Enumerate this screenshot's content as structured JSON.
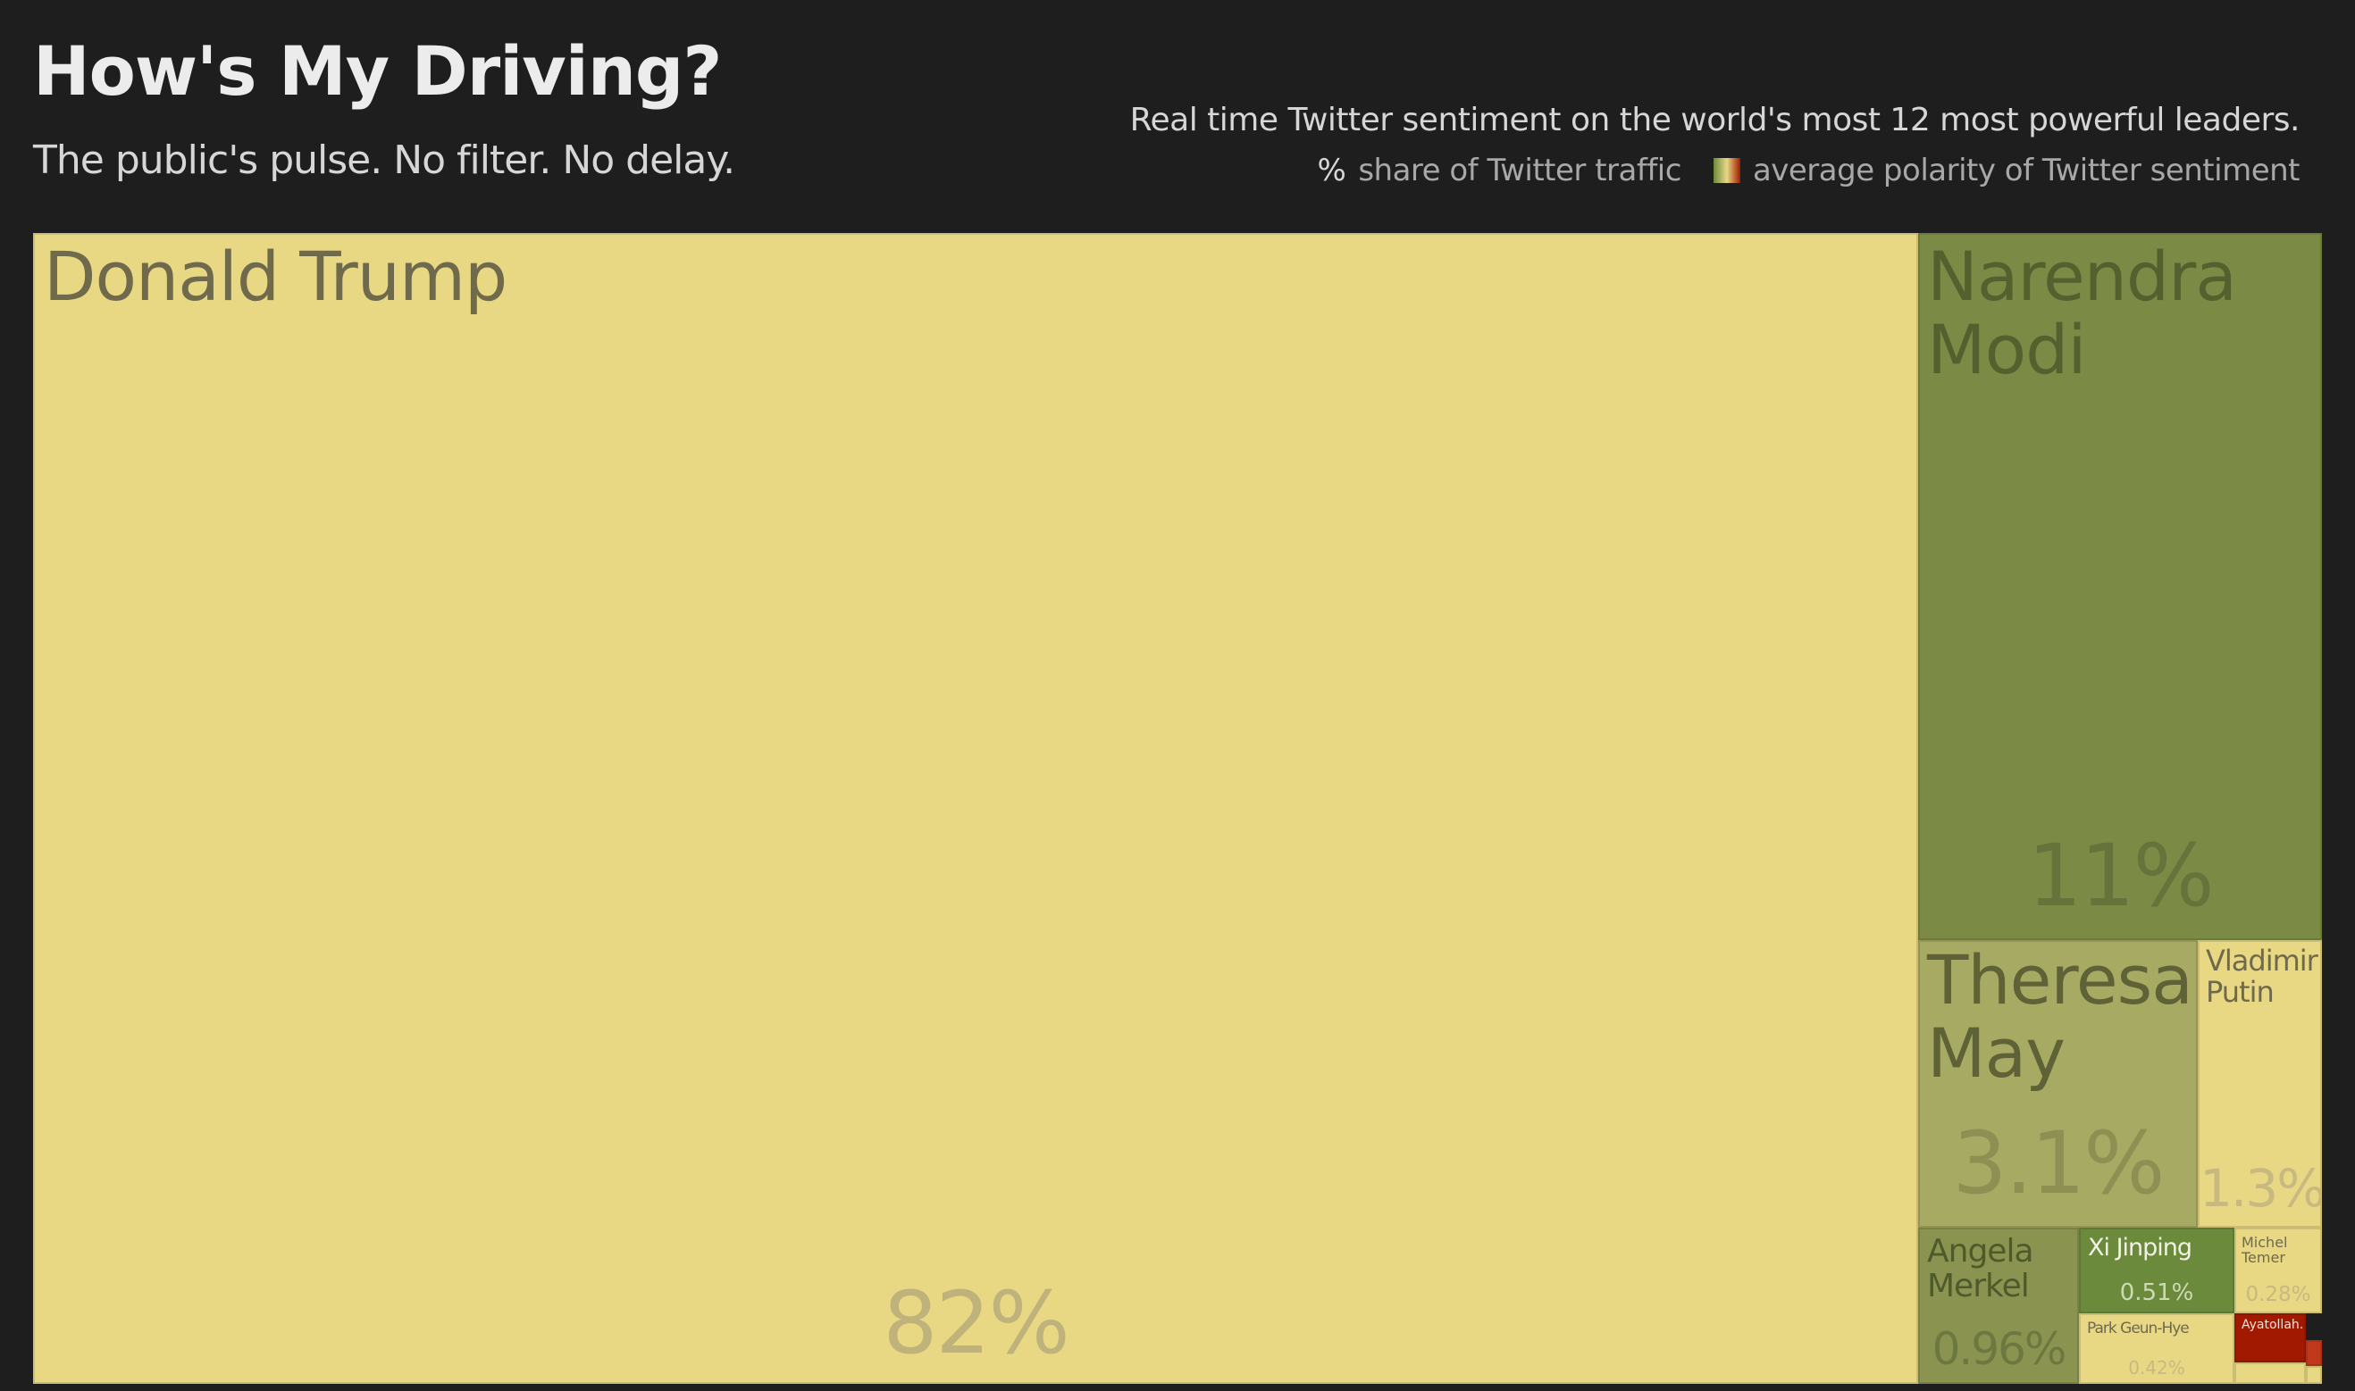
{
  "header": {
    "title": "How's My Driving?",
    "subtitle": "The public's pulse. No filter. No delay.",
    "description": "Real time Twitter sentiment on the world's most 12 most powerful leaders.",
    "legend_symbol": "%",
    "legend_share_label": "share of Twitter traffic",
    "legend_polarity_label": "average polarity of Twitter sentiment"
  },
  "colors": {
    "background": "#1e1e1e",
    "positive": "#6b8a3c",
    "neutral": "#e8d884",
    "negative": "#a11a00"
  },
  "chart_data": {
    "type": "treemap",
    "items": [
      {
        "name": "Donald Trump",
        "label": "Donald Trump",
        "share_label": "82%",
        "share": 82,
        "color": "#e8d884"
      },
      {
        "name": "Narendra Modi",
        "label": "Narendra\nModi",
        "share_label": "11%",
        "share": 11,
        "color": "#7b8b45"
      },
      {
        "name": "Theresa May",
        "label": "Theresa\nMay",
        "share_label": "3.1%",
        "share": 3.1,
        "color": "#a7aa62"
      },
      {
        "name": "Vladimir Putin",
        "label": "Vladimir\nPutin",
        "share_label": "1.3%",
        "share": 1.3,
        "color": "#e8d884"
      },
      {
        "name": "Angela Merkel",
        "label": "Angela\nMerkel",
        "share_label": "0.96%",
        "share": 0.96,
        "color": "#8a9450"
      },
      {
        "name": "Xi Jinping",
        "label": "Xi Jinping",
        "share_label": "0.51%",
        "share": 0.51,
        "color": "#6b8a3c"
      },
      {
        "name": "Michel Temer",
        "label": "Michel\nTemer",
        "share_label": "0.28%",
        "share": 0.28,
        "color": "#e8d884"
      },
      {
        "name": "Park Geun-Hye",
        "label": "Park Geun-Hye",
        "share_label": "0.42%",
        "share": 0.42,
        "color": "#e8d884"
      },
      {
        "name": "Ayatollah...",
        "label": "Ayatollah...",
        "share_label": "",
        "share": null,
        "color": "#a11a00"
      },
      {
        "name": "",
        "label": "",
        "share_label": "",
        "share": null,
        "color": "#e8d884"
      },
      {
        "name": "",
        "label": "",
        "share_label": "",
        "share": null,
        "color": "#c0391b"
      },
      {
        "name": "",
        "label": "",
        "share_label": "",
        "share": null,
        "color": "#e8d884"
      }
    ]
  }
}
